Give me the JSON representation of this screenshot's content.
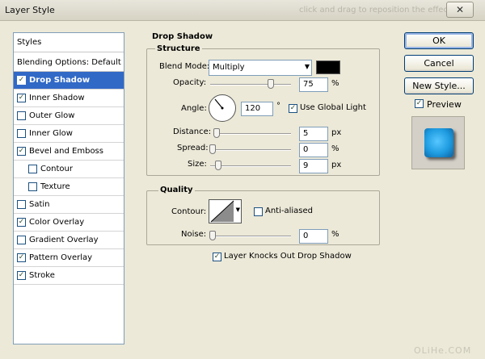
{
  "window": {
    "title": "Layer Style",
    "ghost_text": "click and drag to reposition the effect",
    "close_label": "✕"
  },
  "styles_panel": {
    "header": "Styles",
    "blending_options": "Blending Options: Default",
    "items": [
      {
        "label": "Drop Shadow",
        "checked": true,
        "selected": true,
        "indent": false
      },
      {
        "label": "Inner Shadow",
        "checked": true,
        "selected": false,
        "indent": false
      },
      {
        "label": "Outer Glow",
        "checked": false,
        "selected": false,
        "indent": false
      },
      {
        "label": "Inner Glow",
        "checked": false,
        "selected": false,
        "indent": false
      },
      {
        "label": "Bevel and Emboss",
        "checked": true,
        "selected": false,
        "indent": false
      },
      {
        "label": "Contour",
        "checked": false,
        "selected": false,
        "indent": true
      },
      {
        "label": "Texture",
        "checked": false,
        "selected": false,
        "indent": true
      },
      {
        "label": "Satin",
        "checked": false,
        "selected": false,
        "indent": false
      },
      {
        "label": "Color Overlay",
        "checked": true,
        "selected": false,
        "indent": false
      },
      {
        "label": "Gradient Overlay",
        "checked": false,
        "selected": false,
        "indent": false
      },
      {
        "label": "Pattern Overlay",
        "checked": true,
        "selected": false,
        "indent": false
      },
      {
        "label": "Stroke",
        "checked": true,
        "selected": false,
        "indent": false
      }
    ]
  },
  "drop_shadow": {
    "title": "Drop Shadow",
    "structure": {
      "title": "Structure",
      "blend_mode_label": "Blend Mode:",
      "blend_mode_value": "Multiply",
      "shadow_color": "#000000",
      "opacity_label": "Opacity:",
      "opacity_value": "75",
      "opacity_level": 0.75,
      "opacity_unit": "%",
      "angle_label": "Angle:",
      "angle_value": "120",
      "angle_unit": "°",
      "use_global_light_label": "Use Global Light",
      "use_global_light": true,
      "distance_label": "Distance:",
      "distance_value": "5",
      "distance_unit": "px",
      "spread_label": "Spread:",
      "spread_value": "0",
      "spread_unit": "%",
      "size_label": "Size:",
      "size_value": "9",
      "size_unit": "px"
    },
    "quality": {
      "title": "Quality",
      "contour_label": "Contour:",
      "anti_aliased_label": "Anti-aliased",
      "anti_aliased": false,
      "noise_label": "Noise:",
      "noise_value": "0",
      "noise_unit": "%"
    },
    "knocks_out_label": "Layer Knocks Out Drop Shadow",
    "knocks_out": true
  },
  "buttons": {
    "ok": "OK",
    "cancel": "Cancel",
    "new_style": "New Style...",
    "preview_label": "Preview",
    "preview_checked": true
  },
  "watermark": "OLiHe.COM",
  "colors": {
    "selection": "#3169c6",
    "dialog_bg": "#ece9d8",
    "preview_tile": "#1e9be0"
  }
}
